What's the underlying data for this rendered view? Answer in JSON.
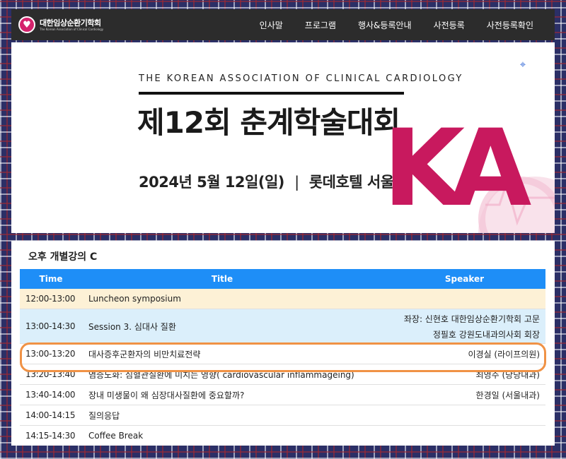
{
  "nav": {
    "logo_text": "대한임상순환기학회",
    "logo_sub": "The Korean Association of Clinical Cardiology",
    "menu": [
      "인사말",
      "프로그램",
      "행사&등록안내",
      "사전등록",
      "사전등록확인"
    ]
  },
  "banner": {
    "eng_title": "THE KOREAN ASSOCIATION OF CLINICAL CARDIOLOGY",
    "kr_title": "제12회 춘계학술대회",
    "date": "2024년 5월 12일(일)",
    "separator": "|",
    "venue": "롯데호텔 서울",
    "ka": "KA"
  },
  "schedule": {
    "title": "오후 개별강의 C",
    "headers": {
      "time": "Time",
      "title": "Title",
      "speaker": "Speaker"
    },
    "rows": [
      {
        "time": "12:00-13:00",
        "title": "Luncheon symposium",
        "speaker": ""
      },
      {
        "time": "13:00-14:30",
        "title": "Session 3. 심대사 질환",
        "chair1": "좌장: 신현호 대한임상순환기학회 고문",
        "chair2": "정필호 강원도내과의사회 회장"
      },
      {
        "time": "13:00-13:20",
        "title": "대사증후군환자의 비만치료전략",
        "speaker": "이경실 (라이프의원)"
      },
      {
        "time": "13:20-13:40",
        "title": "염증노화: 심혈관질환에 미치는 영향( cardiovascular inflammageing)",
        "speaker": "최영주 (당당내과)"
      },
      {
        "time": "13:40-14:00",
        "title": "장내 미생물이 왜 심장대사질환에 중요할까?",
        "speaker": "한경일 (서울내과)"
      },
      {
        "time": "14:00-14:15",
        "title": "질의응답",
        "speaker": ""
      },
      {
        "time": "14:15-14:30",
        "title": "Coffee Break",
        "speaker": ""
      }
    ]
  },
  "colors": {
    "header_blue": "#1e8ef7",
    "lunch_bg": "#fdf1d6",
    "session_bg": "#dbeffb",
    "highlight": "#f09245",
    "ka_pink": "#c8195e"
  }
}
